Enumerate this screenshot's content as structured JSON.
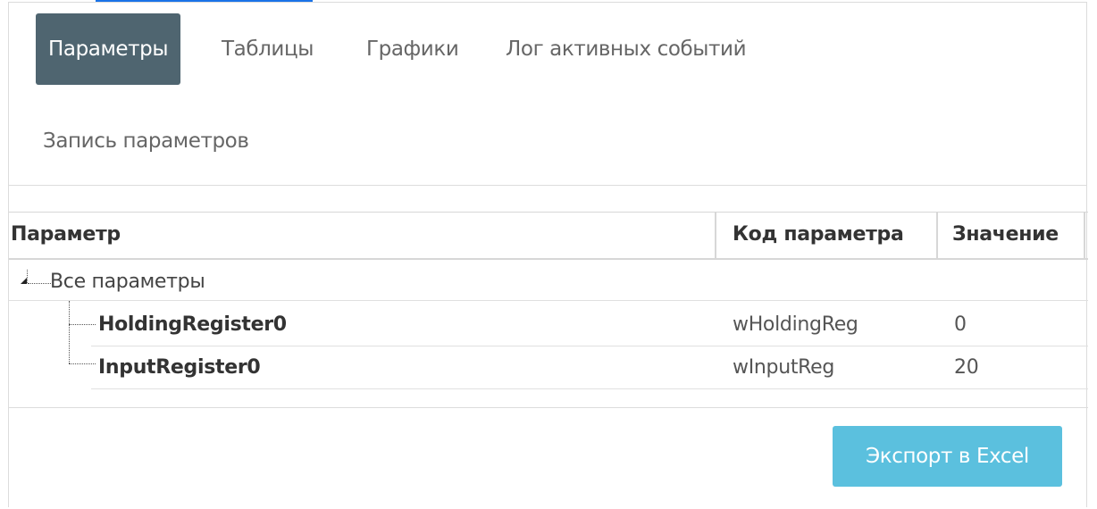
{
  "tabs": [
    {
      "label": "Параметры",
      "active": true
    },
    {
      "label": "Таблицы",
      "active": false
    },
    {
      "label": "Графики",
      "active": false
    },
    {
      "label": "Лог активных событий",
      "active": false
    },
    {
      "label": "Запись параметров",
      "active": false
    }
  ],
  "grid": {
    "columns": [
      "Параметр",
      "Код параметра",
      "Значение"
    ],
    "root": {
      "label": "Все параметры",
      "expanded": true
    },
    "rows": [
      {
        "name": "HoldingRegister0",
        "code": "wHoldingReg",
        "value": "0"
      },
      {
        "name": "InputRegister0",
        "code": "wInputReg",
        "value": "20"
      }
    ]
  },
  "actions": {
    "export_label": "Экспорт в Excel"
  },
  "colors": {
    "active_tab_bg": "#4f6570",
    "export_button_bg": "#5bc0de",
    "top_link": "#1a73e8"
  }
}
